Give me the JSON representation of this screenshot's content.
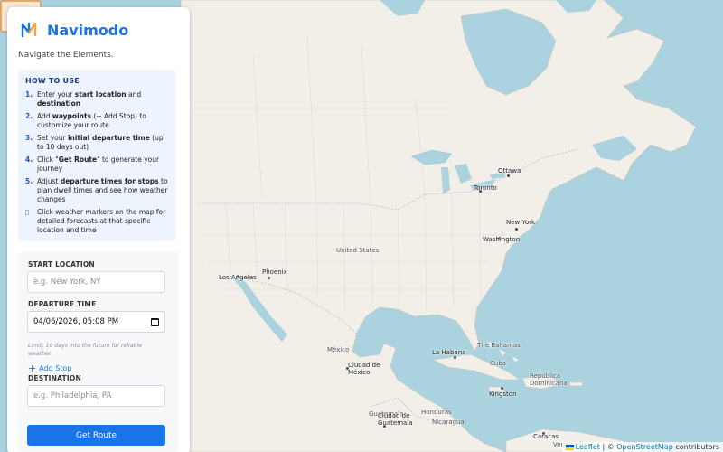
{
  "app": {
    "title": "Navimodo",
    "tagline": "Navigate the Elements."
  },
  "howto": {
    "title": "HOW TO USE",
    "steps": [
      {
        "num": "1.",
        "pre": "Enter your ",
        "b1": "start location",
        "mid": " and ",
        "b2": "destination",
        "post": ""
      },
      {
        "num": "2.",
        "pre": "Add ",
        "b1": "waypoints",
        "mid": " (+ Add Stop) to customize your route",
        "b2": "",
        "post": ""
      },
      {
        "num": "3.",
        "pre": "Set your ",
        "b1": "initial departure time",
        "mid": " (up to 10 days out)",
        "b2": "",
        "post": ""
      },
      {
        "num": "4.",
        "pre": "Click \"",
        "b1": "Get Route",
        "mid": "\" to generate your journey",
        "b2": "",
        "post": ""
      },
      {
        "num": "5.",
        "pre": "Adjust ",
        "b1": "departure times for stops",
        "mid": " to plan dwell times and see how weather changes",
        "b2": "",
        "post": ""
      }
    ],
    "tip_icon": "▯",
    "tip": "Click weather markers on the map for detailed forecasts at that specific location and time"
  },
  "form": {
    "start_label": "START LOCATION",
    "start_placeholder": "e.g. New York, NY",
    "start_value": "",
    "departure_label": "DEPARTURE TIME",
    "departure_value": "04/06/2026, 05:08 PM",
    "hint": "Limit: 10 days into the future for reliable weather",
    "add_stop": "Add Stop",
    "add_stop_icon": "+",
    "destination_label": "DESTINATION",
    "destination_placeholder": "e.g. Philadelphia, PA",
    "destination_value": "",
    "get_route": "Get Route"
  },
  "map": {
    "labels": [
      {
        "name": "city-ottawa",
        "text": "Ottawa",
        "kind": "city"
      },
      {
        "name": "city-toronto",
        "text": "Toronto",
        "kind": "city"
      },
      {
        "name": "city-new-york",
        "text": "New York",
        "kind": "city"
      },
      {
        "name": "city-washington",
        "text": "Washington",
        "kind": "city"
      },
      {
        "name": "country-united-states",
        "text": "United States",
        "kind": "country"
      },
      {
        "name": "city-phoenix",
        "text": "Phoenix",
        "kind": "city"
      },
      {
        "name": "city-los-angeles",
        "text": "Los Angeles",
        "kind": "city"
      },
      {
        "name": "country-mexico",
        "text": "México",
        "kind": "country"
      },
      {
        "name": "city-mexico-city",
        "text": "Ciudad de México",
        "kind": "city"
      },
      {
        "name": "city-la-habana",
        "text": "La Habana",
        "kind": "city"
      },
      {
        "name": "country-bahamas",
        "text": "The Bahamas",
        "kind": "country"
      },
      {
        "name": "country-cuba",
        "text": "Cuba",
        "kind": "country"
      },
      {
        "name": "country-dominican-republic",
        "text": "República Dominicana",
        "kind": "country"
      },
      {
        "name": "city-kingston",
        "text": "Kingston",
        "kind": "city"
      },
      {
        "name": "country-guatemala",
        "text": "Guatemala",
        "kind": "country"
      },
      {
        "name": "city-ciudad-de-guatemala",
        "text": "Ciudad de Guatemala",
        "kind": "city"
      },
      {
        "name": "country-honduras",
        "text": "Honduras",
        "kind": "country"
      },
      {
        "name": "country-nicaragua",
        "text": "Nicaragua",
        "kind": "country"
      },
      {
        "name": "city-caracas",
        "text": "Caracas",
        "kind": "city"
      },
      {
        "name": "country-venezuela",
        "text": "Venezuela",
        "kind": "country"
      }
    ],
    "attribution_leaflet": "Leaflet",
    "attribution_sep": " | © ",
    "attribution_osm": "OpenStreetMap",
    "attribution_tail": " contributors"
  },
  "colors": {
    "accent": "#1a73e8",
    "water": "#aad3df",
    "land": "#f2efe9"
  }
}
